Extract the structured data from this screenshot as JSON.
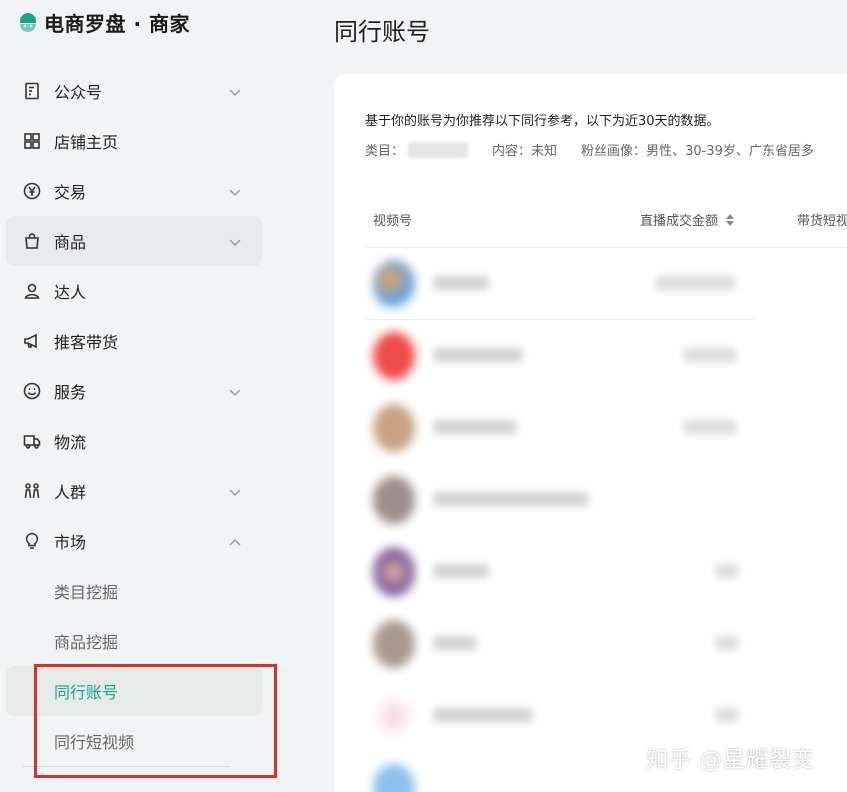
{
  "brand": {
    "name": "电商罗盘 · 商家",
    "logo_icon": "compass-logo-icon",
    "accent": "#17a58a"
  },
  "sidebar": {
    "items": [
      {
        "label": "公众号",
        "icon": "document-icon",
        "chevron": "down"
      },
      {
        "label": "店铺主页",
        "icon": "grid-icon",
        "chevron": ""
      },
      {
        "label": "交易",
        "icon": "yen-icon",
        "chevron": "down"
      },
      {
        "label": "商品",
        "icon": "bag-icon",
        "chevron": "down"
      },
      {
        "label": "达人",
        "icon": "person-icon",
        "chevron": ""
      },
      {
        "label": "推客带货",
        "icon": "megaphone-icon",
        "chevron": ""
      },
      {
        "label": "服务",
        "icon": "smile-icon",
        "chevron": "down"
      },
      {
        "label": "物流",
        "icon": "truck-icon",
        "chevron": ""
      },
      {
        "label": "人群",
        "icon": "people-icon",
        "chevron": "down"
      },
      {
        "label": "市场",
        "icon": "bulb-icon",
        "chevron": "up"
      }
    ],
    "sub_items": [
      {
        "label": "类目挖掘"
      },
      {
        "label": "商品挖掘"
      },
      {
        "label": "同行账号",
        "active": true
      },
      {
        "label": "同行短视频"
      }
    ]
  },
  "main": {
    "title": "同行账号",
    "intro": "基于你的账号为你推荐以下同行参考，以下为近30天的数据。",
    "meta": {
      "category_label": "类目：",
      "content_label": "内容：",
      "content_value": "未知",
      "fans_label": "粉丝画像：",
      "fans_value": "男性、30-39岁、广东省居多"
    },
    "columns": [
      "视频号",
      "直播成交金额",
      "带货短视"
    ]
  },
  "watermark": "知乎 @星耀裂变"
}
